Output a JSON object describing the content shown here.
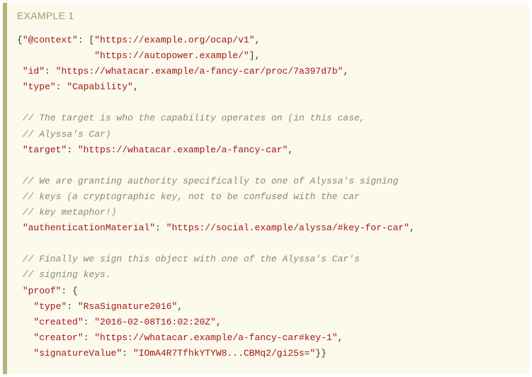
{
  "header": "EXAMPLE 1",
  "l0a": "{",
  "l0b": "\"@context\"",
  "l0c": ": [",
  "l0d": "\"https://example.org/ocap/v1\"",
  "l0e": ",",
  "l1a": "              ",
  "l1b": "\"https://autopower.example/\"",
  "l1c": "],",
  "l2a": " ",
  "l2b": "\"id\"",
  "l2c": ": ",
  "l2d": "\"https://whatacar.example/a-fancy-car/proc/7a397d7b\"",
  "l2e": ",",
  "l3a": " ",
  "l3b": "\"type\"",
  "l3c": ": ",
  "l3d": "\"Capability\"",
  "l3e": ",",
  "cm1": " // The target is who the capability operates on (in this case,",
  "cm2": " // Alyssa's Car)",
  "l6a": " ",
  "l6b": "\"target\"",
  "l6c": ": ",
  "l6d": "\"https://whatacar.example/a-fancy-car\"",
  "l6e": ",",
  "cm3": " // We are granting authority specifically to one of Alyssa's signing",
  "cm4": " // keys (a cryptographic key, not to be confused with the car",
  "cm5": " // key metaphor!)",
  "l10a": " ",
  "l10b": "\"authenticationMaterial\"",
  "l10c": ": ",
  "l10d": "\"https://social.example/alyssa/#key-for-car\"",
  "l10e": ",",
  "cm6": " // Finally we sign this object with one of the Alyssa's Car's",
  "cm7": " // signing keys.",
  "l13a": " ",
  "l13b": "\"proof\"",
  "l13c": ": {",
  "l14a": "   ",
  "l14b": "\"type\"",
  "l14c": ": ",
  "l14d": "\"RsaSignature2016\"",
  "l14e": ",",
  "l15a": "   ",
  "l15b": "\"created\"",
  "l15c": ": ",
  "l15d": "\"2016-02-08T16:02:20Z\"",
  "l15e": ",",
  "l16a": "   ",
  "l16b": "\"creator\"",
  "l16c": ": ",
  "l16d": "\"https://whatacar.example/a-fancy-car#key-1\"",
  "l16e": ",",
  "l17a": "   ",
  "l17b": "\"signatureValue\"",
  "l17c": ": ",
  "l17d": "\"IOmA4R7TfhkYTYW8...CBMq2/gi25s=\"",
  "l17e": "}}"
}
